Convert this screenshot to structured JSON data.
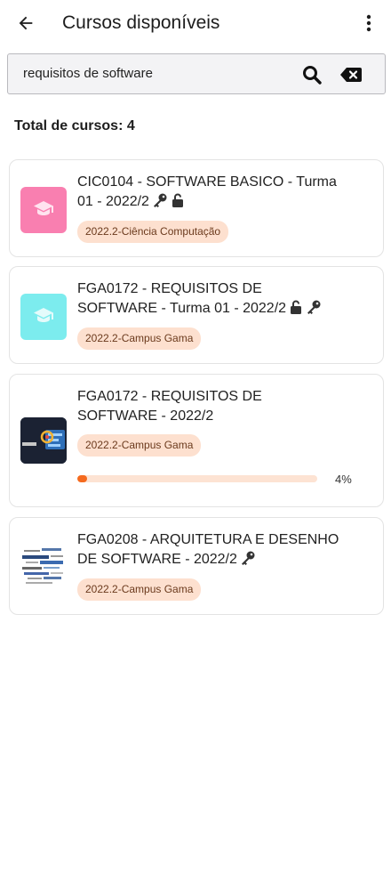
{
  "header": {
    "title": "Cursos disponíveis"
  },
  "search": {
    "value": "requisitos de software"
  },
  "summary": {
    "total_label": "Total de cursos: 4"
  },
  "colors": {
    "accent": "#f56a1e",
    "tag_bg": "#fde0cf",
    "thumb_pink": "#f97fb0",
    "thumb_cyan": "#7cecee"
  },
  "courses": [
    {
      "title": "CIC0104 - SOFTWARE BASICO - Turma 01 - 2022/2",
      "icons": [
        "key-icon",
        "unlock-icon"
      ],
      "tag": "2022.2-Ciência Computação",
      "thumb": "graduation-cap-icon"
    },
    {
      "title": "FGA0172 - REQUISITOS DE SOFTWARE - Turma 01 - 2022/2",
      "icons": [
        "unlock-icon",
        "key-icon"
      ],
      "tag": "2022.2-Campus Gama",
      "thumb": "graduation-cap-icon"
    },
    {
      "title": "FGA0172 - REQUISITOS DE SOFTWARE - 2022/2",
      "icons": [],
      "tag": "2022.2-Campus Gama",
      "thumb": "course-image",
      "progress": 0.04,
      "progress_label": "4%"
    },
    {
      "title": "FGA0208 - ARQUITETURA E DESENHO DE SOFTWARE - 2022/2",
      "icons": [
        "key-icon"
      ],
      "tag": "2022.2-Campus Gama",
      "thumb": "word-cloud-image"
    }
  ]
}
